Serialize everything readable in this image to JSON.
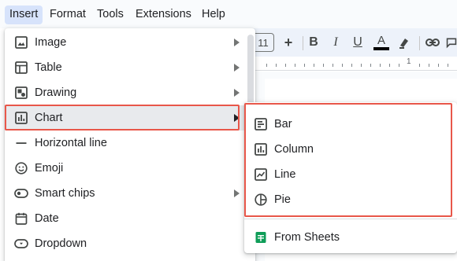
{
  "menubar": {
    "items": [
      {
        "label": "Insert",
        "active": true
      },
      {
        "label": "Format"
      },
      {
        "label": "Tools"
      },
      {
        "label": "Extensions"
      },
      {
        "label": "Help"
      }
    ]
  },
  "toolbar": {
    "font_size": "11",
    "increase": "+",
    "bold": "B",
    "italic": "I",
    "underline": "U",
    "text_color": "A",
    "icons": [
      "bold-icon",
      "italic-icon",
      "underline-icon",
      "text-color-icon",
      "highlight-icon",
      "link-icon",
      "comment-icon"
    ]
  },
  "ruler": {
    "number": "1"
  },
  "insert_menu": {
    "items": [
      {
        "label": "Image",
        "icon": "image-icon",
        "submenu": true
      },
      {
        "label": "Table",
        "icon": "table-icon",
        "submenu": true
      },
      {
        "label": "Drawing",
        "icon": "drawing-icon",
        "submenu": true
      },
      {
        "label": "Chart",
        "icon": "chart-icon",
        "submenu": true,
        "highlighted": true
      },
      {
        "label": "Horizontal line",
        "icon": "horizontal-line-icon",
        "submenu": false
      },
      {
        "label": "Emoji",
        "icon": "emoji-icon",
        "submenu": false
      },
      {
        "label": "Smart chips",
        "icon": "smart-chips-icon",
        "submenu": true
      },
      {
        "label": "Date",
        "icon": "date-icon",
        "submenu": false
      },
      {
        "label": "Dropdown",
        "icon": "dropdown-icon",
        "submenu": false
      }
    ]
  },
  "chart_submenu": {
    "items": [
      {
        "label": "Bar",
        "icon": "bar-chart-icon"
      },
      {
        "label": "Column",
        "icon": "column-chart-icon"
      },
      {
        "label": "Line",
        "icon": "line-chart-icon"
      },
      {
        "label": "Pie",
        "icon": "pie-chart-icon"
      }
    ],
    "from_sheets": {
      "label": "From Sheets",
      "icon": "sheets-icon"
    }
  },
  "colors": {
    "highlight_outline": "#e8574a",
    "menu_active": "#d7e3fb",
    "sheets_green": "#0f9d58"
  }
}
